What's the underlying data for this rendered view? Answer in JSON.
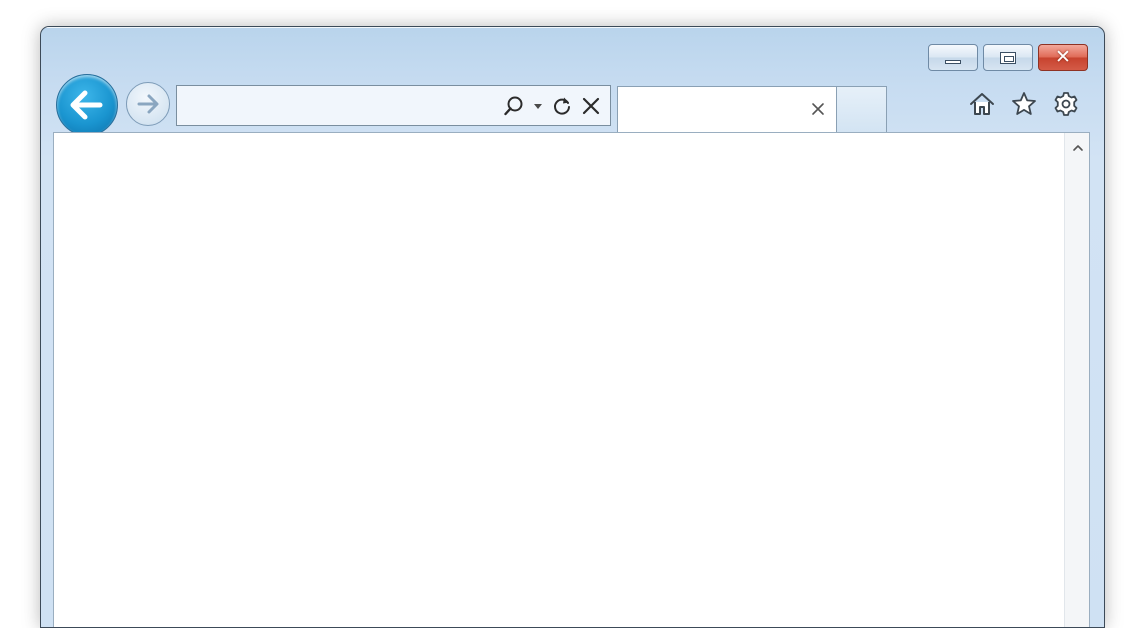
{
  "window": {
    "title": "",
    "caption_buttons": {
      "minimize": "minimize",
      "maximize": "maximize",
      "close": "close"
    }
  },
  "toolbar": {
    "back_icon": "back-arrow-icon",
    "forward_icon": "forward-arrow-icon",
    "address": {
      "value": "",
      "placeholder": "",
      "icons": [
        "search-icon",
        "dropdown-arrow-icon",
        "refresh-icon",
        "stop-icon"
      ]
    }
  },
  "tab": {
    "title": "",
    "close_icon": "close-tab-icon"
  },
  "tools": [
    "home-icon",
    "favorites-star-icon",
    "settings-gear-icon"
  ],
  "colors": {
    "frame": "#c7dcf1",
    "accent_back": "#1a95d0",
    "close_button": "#d45b47"
  }
}
